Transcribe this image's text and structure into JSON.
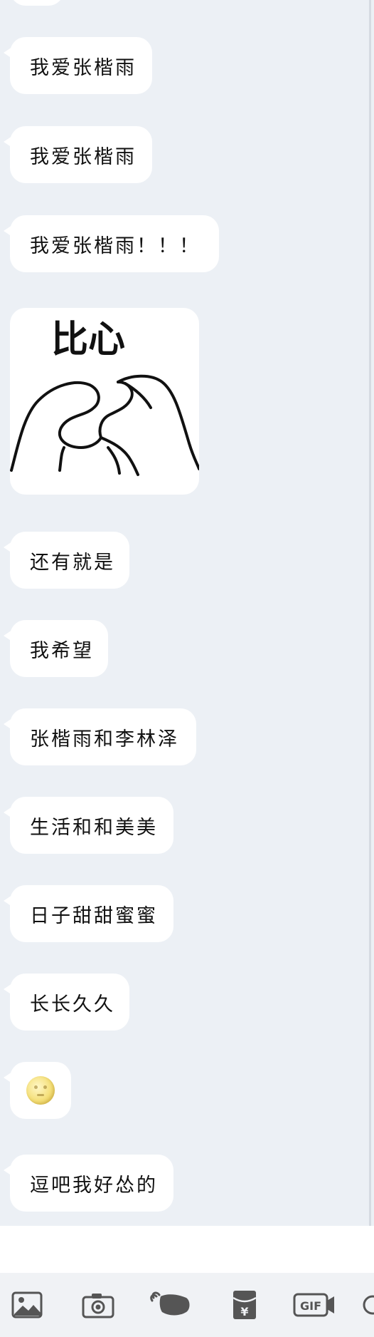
{
  "messages": [
    {
      "text": "我爱张楷雨"
    },
    {
      "text": "我爱张楷雨"
    },
    {
      "text": "我爱张楷雨！！！"
    },
    {
      "sticker_text": "比心"
    },
    {
      "text": "还有就是"
    },
    {
      "text": "我希望"
    },
    {
      "text": "张楷雨和李林泽"
    },
    {
      "text": "生活和和美美"
    },
    {
      "text": "日子甜甜蜜蜜"
    },
    {
      "text": "长长久久"
    },
    {
      "emoji": "moon-face-emoji"
    },
    {
      "text": "逗吧我好怂的"
    }
  ],
  "toolbar": {
    "icons": [
      "image-icon",
      "camera-icon",
      "voice-icon",
      "red-packet-icon",
      "gif-icon"
    ],
    "gif_label": "GIF",
    "yen_label": "¥"
  }
}
